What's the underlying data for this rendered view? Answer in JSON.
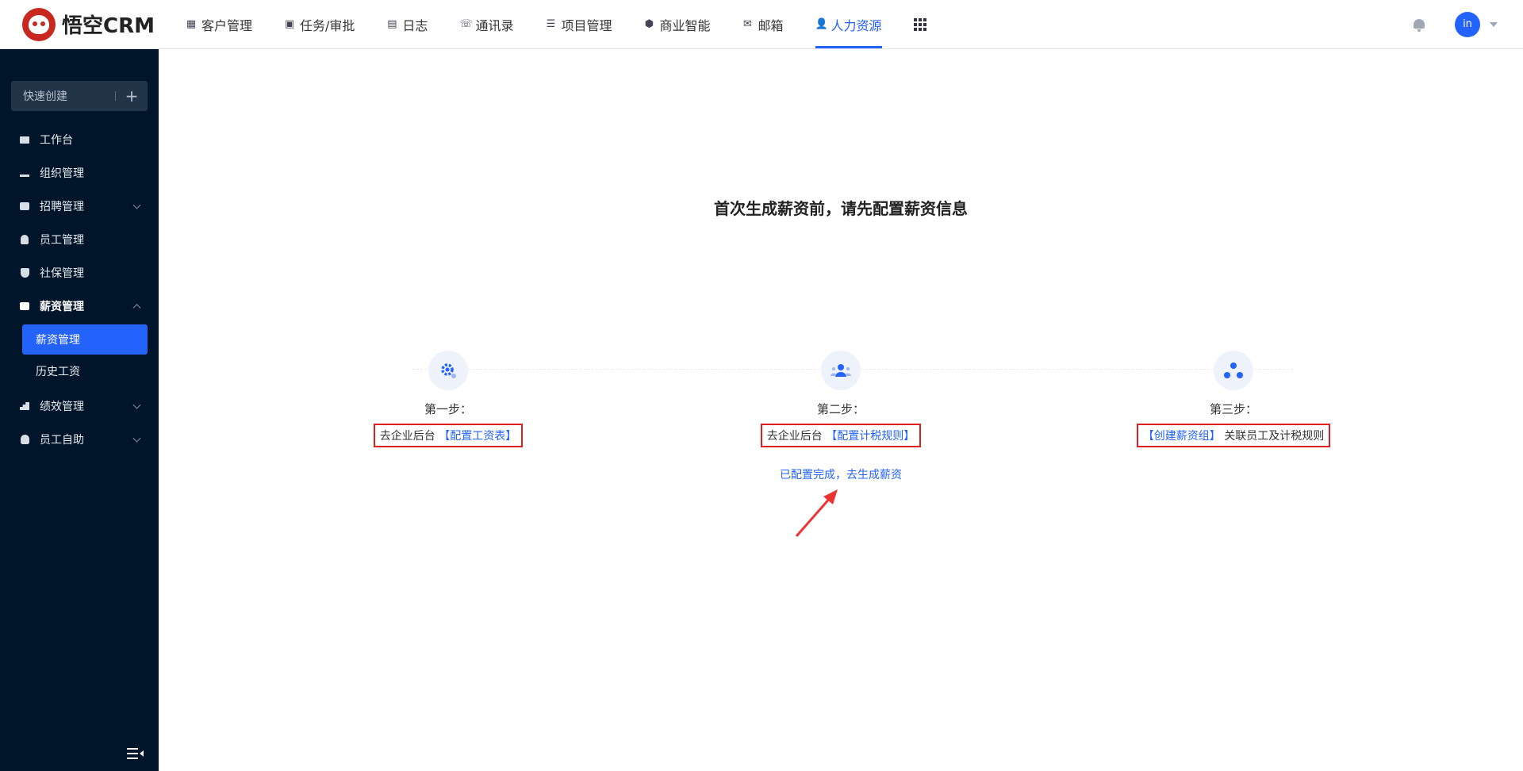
{
  "app": {
    "logo_text": "悟空CRM"
  },
  "nav": {
    "items": [
      {
        "label": "客户管理",
        "icon": "building-icon"
      },
      {
        "label": "任务/审批",
        "icon": "briefcase-icon"
      },
      {
        "label": "日志",
        "icon": "notebook-icon"
      },
      {
        "label": "通讯录",
        "icon": "phone-book-icon"
      },
      {
        "label": "项目管理",
        "icon": "list-icon"
      },
      {
        "label": "商业智能",
        "icon": "cube-icon"
      },
      {
        "label": "邮箱",
        "icon": "mail-icon"
      },
      {
        "label": "人力资源",
        "icon": "people-icon",
        "active": true
      }
    ],
    "avatar_text": "in"
  },
  "sidebar": {
    "quick_create": "快速创建",
    "items": [
      {
        "label": "工作台"
      },
      {
        "label": "组织管理"
      },
      {
        "label": "招聘管理"
      },
      {
        "label": "员工管理"
      },
      {
        "label": "社保管理"
      },
      {
        "label": "薪资管理",
        "expanded": true
      },
      {
        "label": "绩效管理"
      },
      {
        "label": "员工自助"
      }
    ],
    "sub_items": [
      {
        "label": "薪资管理",
        "active": true
      },
      {
        "label": "历史工资"
      }
    ]
  },
  "main": {
    "heading": "首次生成薪资前，请先配置薪资信息",
    "steps": [
      {
        "title": "第一步：",
        "text_before": "去企业后台 ",
        "link": "【配置工资表】",
        "text_after": ""
      },
      {
        "title": "第二步：",
        "text_before": "去企业后台 ",
        "link": "【配置计税规则】",
        "text_after": ""
      },
      {
        "title": "第三步：",
        "text_before": "",
        "link": "【创建薪资组】",
        "text_after": " 关联员工及计税规则"
      }
    ],
    "done_link": "已配置完成，去生成薪资"
  },
  "colors": {
    "accent": "#2362fb",
    "sidebar_bg": "#001529",
    "highlight_box": "#e02020"
  }
}
